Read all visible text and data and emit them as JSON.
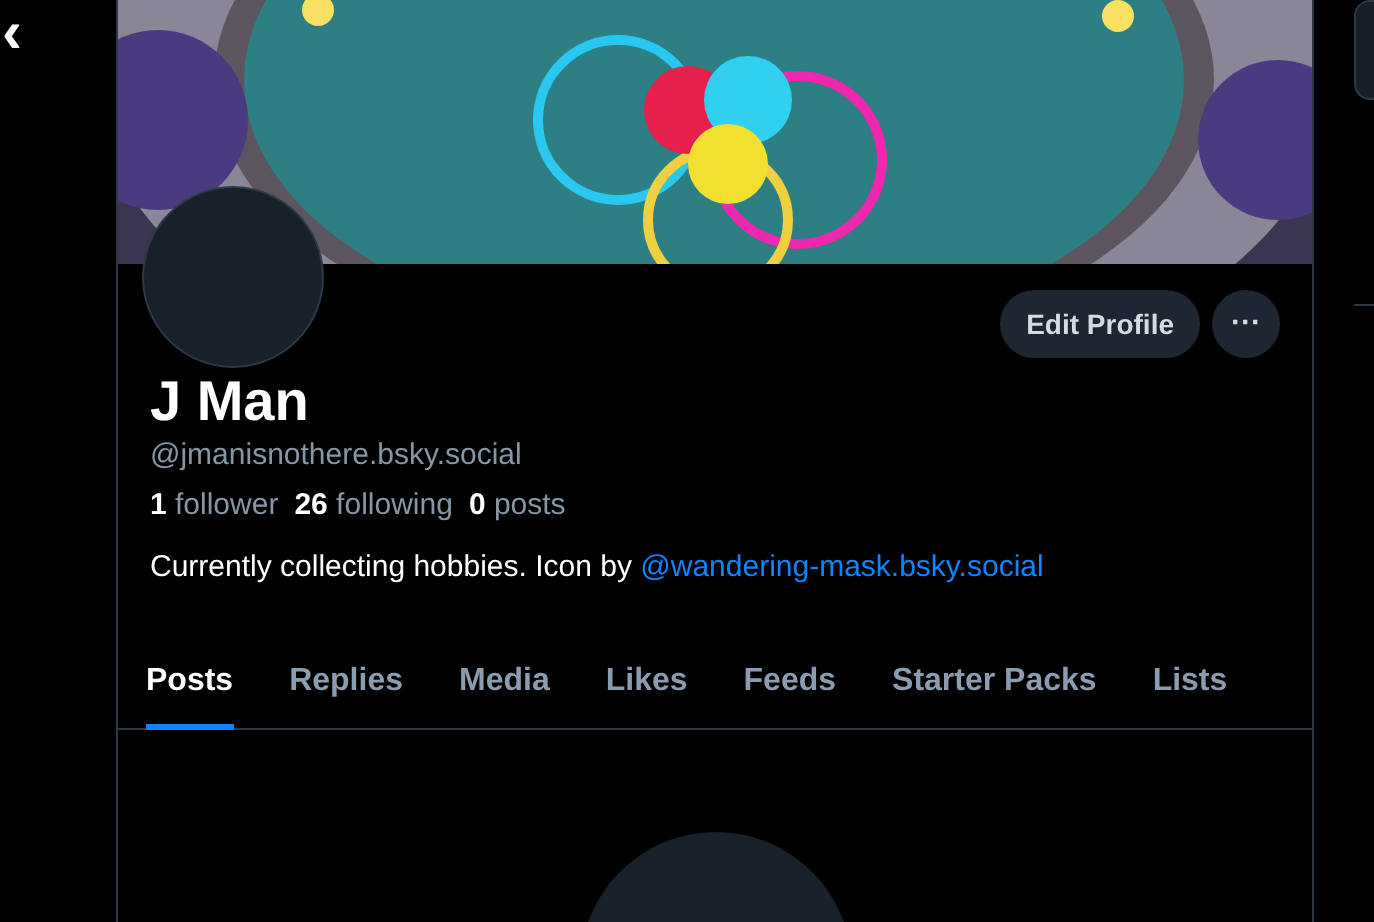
{
  "back_button": {
    "glyph": "‹"
  },
  "profile": {
    "display_name": "J Man",
    "handle": "@jmanisnothere.bsky.social",
    "stats": [
      {
        "text": "**1** follower"
      },
      {
        "text": "**26** following"
      },
      {
        "text": "**0** posts"
      }
    ],
    "bio": {
      "text": "Currently collecting hobbies. Icon by",
      "link": "@wandering-mask.bsky.social"
    }
  },
  "actions": {
    "edit_button": "Edit Profile",
    "more_button": "···"
  },
  "tabs": [
    {
      "label": "Posts",
      "selected": true
    },
    {
      "label": "Replies",
      "selected": false
    },
    {
      "label": "Media",
      "selected": false
    },
    {
      "label": "Likes",
      "selected": false
    },
    {
      "label": "Feeds",
      "selected": false
    },
    {
      "label": "Starter Packs",
      "selected": false
    },
    {
      "label": "Lists",
      "selected": false
    }
  ]
}
